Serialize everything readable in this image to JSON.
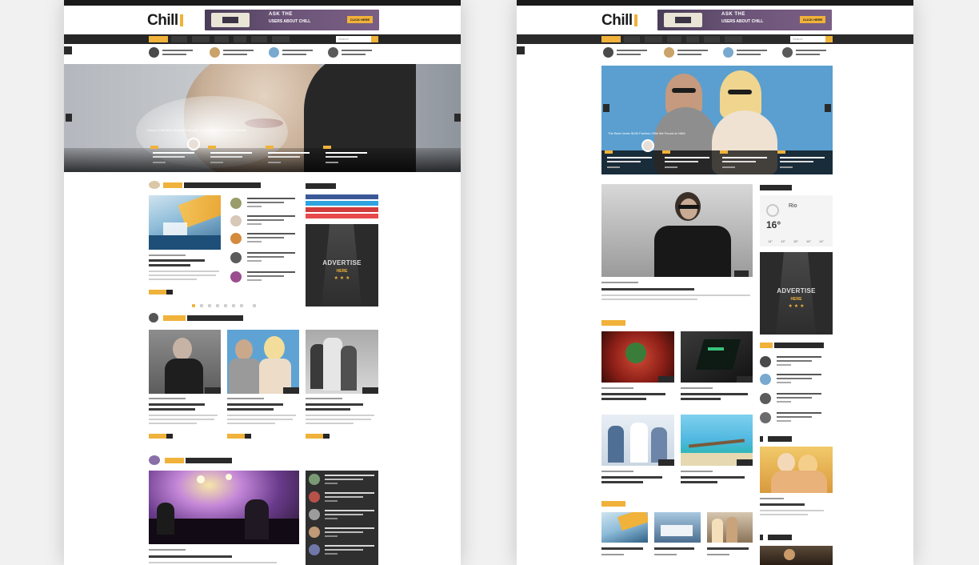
{
  "brand": {
    "logo_text": "Chill",
    "accent": "#f0b23a",
    "dark": "#262626"
  },
  "banner": {
    "line1": "ASK THE",
    "line2": "USERS ABOUT CHILL",
    "button": "CLICK HERE"
  },
  "nav": {
    "search_placeholder": "Search"
  },
  "left_page": {
    "hero_caption": "How to Chill When Beauty, Hairstyle, Routine and Fashion in Australia",
    "ad_text": "ADVERTISE",
    "ad_sub": "HERE",
    "ad_stars": "★ ★ ★",
    "pager": [
      "1",
      "2",
      "3",
      "4",
      "5",
      "6",
      "7"
    ]
  },
  "right_page": {
    "hero_caption": "The Best Under $100 Fashion Gifts We Found at H&M",
    "weather": {
      "city": "Rio",
      "temp": "16°",
      "forecast": [
        "14°",
        "13°",
        "15°",
        "16°",
        "14°"
      ]
    },
    "ad_text": "ADVERTISE",
    "ad_sub": "HERE",
    "ad_stars": "★ ★ ★"
  }
}
